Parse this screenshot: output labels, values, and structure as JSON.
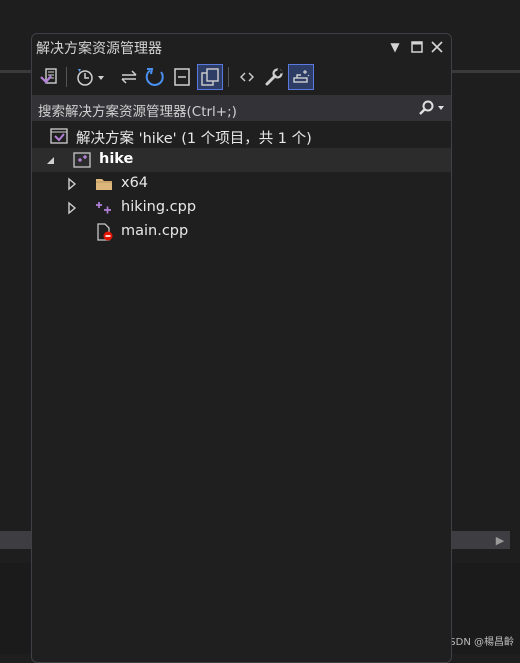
{
  "panel": {
    "title": "解决方案资源管理器",
    "buttons": {
      "dropdown_icon": "chevron-down-icon",
      "maximize_icon": "maximize-icon",
      "close_icon": "close-icon"
    }
  },
  "toolbar": {
    "items": [
      {
        "icon": "solution-switch-icon"
      },
      {
        "icon": "history-icon"
      },
      {
        "icon": "sync-arrows-icon"
      },
      {
        "icon": "refresh-icon"
      },
      {
        "icon": "collapse-all-icon"
      },
      {
        "icon": "show-all-files-icon",
        "active": true
      },
      {
        "icon": "code-view-icon"
      },
      {
        "icon": "properties-wrench-icon"
      },
      {
        "icon": "preview-selected-icon",
        "active": true
      }
    ]
  },
  "search": {
    "placeholder": "搜索解决方案资源管理器(Ctrl+;)"
  },
  "tree": {
    "solution_label": "解决方案 'hike' (1 个项目，共 1 个)",
    "project_label": "hike",
    "items": [
      {
        "label": "x64",
        "icon": "folder-icon"
      },
      {
        "label": "hiking.cpp",
        "icon": "cpp-file-icon"
      },
      {
        "label": "main.cpp",
        "icon": "excluded-file-icon"
      }
    ]
  },
  "watermark": "CSDN @楊昌齡",
  "colors": {
    "accent": "#5a7ae0",
    "vs_purple": "#b180d7",
    "folder": "#dcb67a",
    "error_red": "#e51400"
  }
}
